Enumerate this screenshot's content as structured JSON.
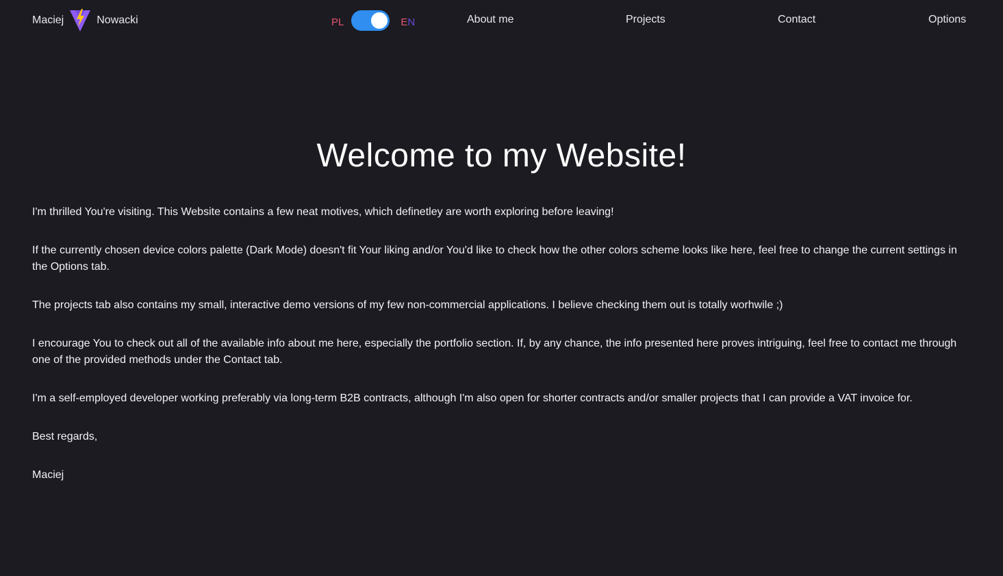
{
  "header": {
    "brand_first": "Maciej",
    "brand_last": "Nowacki",
    "lang_left": "PL",
    "lang_right_first": "E",
    "lang_right_second": "N",
    "nav": {
      "about": "About me",
      "projects": "Projects",
      "contact": "Contact",
      "options": "Options"
    }
  },
  "main": {
    "title": "Welcome to my Website!",
    "paragraphs": [
      "I'm thrilled You're visiting. This Website contains a few neat motives, which definetley are worth exploring before leaving!",
      "If the currently chosen device colors palette (Dark Mode) doesn't fit Your liking and/or You'd like to check how the other colors scheme looks like here, feel free to change the current settings in the Options tab.",
      "The projects tab also contains my small, interactive demo versions of my few non-commercial applications. I believe checking them out is totally worhwile ;)",
      "I encourage You to check out all of the available info about me here, especially the portfolio section. If, by any chance, the info presented here proves intriguing, feel free to contact me through one of the provided methods under the Contact tab.",
      "I'm a self-employed developer working preferably via long-term B2B contracts, although I'm also open for shorter contracts and/or smaller projects that I can provide a VAT invoice for.",
      "Best regards,",
      "Maciej"
    ]
  },
  "colors": {
    "background": "#1c1b21",
    "toggle": "#2f8ef0",
    "lang_red": "#e4566f",
    "lang_purple": "#6b4ad8",
    "logo_purple": "#8e5cf5",
    "logo_yellow": "#ffc517"
  },
  "icons": {
    "logo": "vite-lightning-logo-icon"
  }
}
